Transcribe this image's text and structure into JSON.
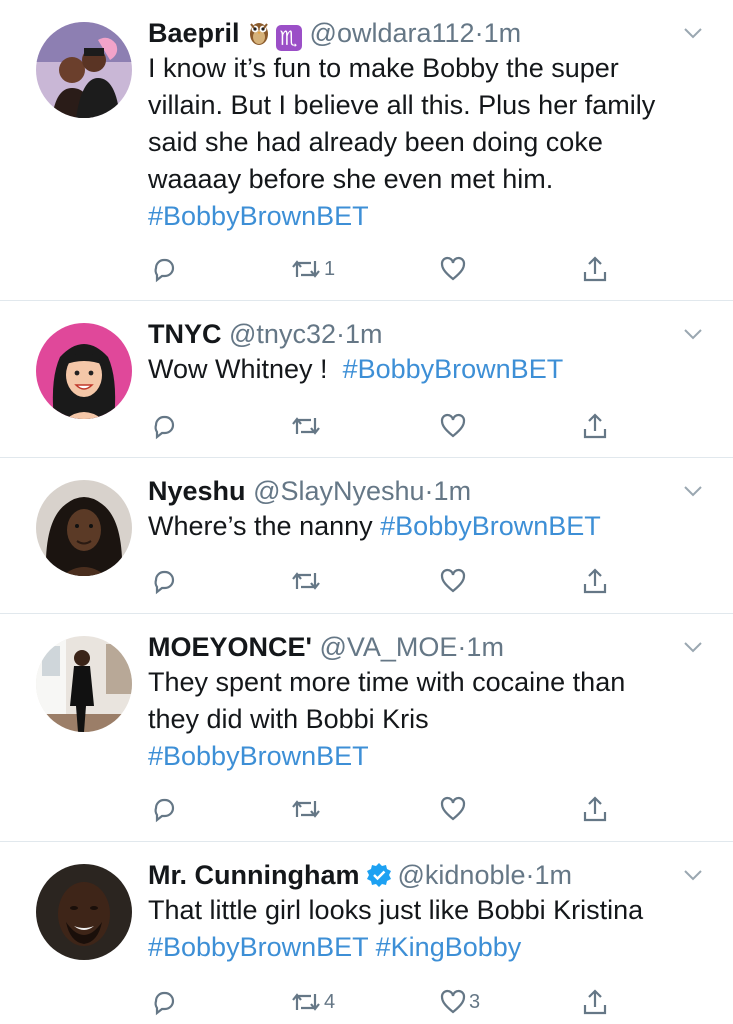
{
  "tweets": [
    {
      "name": "Baepril",
      "emoji_owl": "owl-emoji",
      "zodiac": "♏",
      "handle": "@owldara112",
      "separator": "·",
      "time": "1m",
      "text_lines": [
        "I know it’s fun to make Bobby the super",
        "villain. But I believe all this. Plus her family",
        "said she had already been doing coke",
        "waaaay before she even met him."
      ],
      "hashtags": [
        "#BobbyBrownBET"
      ],
      "retweets": "1",
      "likes": ""
    },
    {
      "name": "TNYC",
      "handle": "@tnyc32",
      "separator": "·",
      "time": "1m",
      "text": "Wow Whitney !",
      "hashtags": [
        "#BobbyBrownBET"
      ],
      "retweets": "",
      "likes": ""
    },
    {
      "name": "Nyeshu",
      "handle": "@SlayNyeshu",
      "separator": "·",
      "time": "1m",
      "text": "Where’s the nanny",
      "hashtags": [
        "#BobbyBrownBET"
      ],
      "retweets": "",
      "likes": ""
    },
    {
      "name": "MOEYONCE'",
      "handle": "@VA_MOE",
      "separator": "·",
      "time": "1m",
      "text_lines": [
        "They spent more time with cocaine than",
        "they did with Bobbi Kris"
      ],
      "hashtags": [
        "#BobbyBrownBET"
      ],
      "retweets": "",
      "likes": ""
    },
    {
      "name": "Mr. Cunningham",
      "verified": true,
      "handle": "@kidnoble",
      "separator": "·",
      "time": "1m",
      "text": "That little girl looks just like Bobbi Kristina",
      "hashtags": [
        "#BobbyBrownBET",
        "#KingBobby"
      ],
      "retweets": "4",
      "likes": "3"
    }
  ],
  "colors": {
    "accent": "#3d8fd6",
    "muted": "#657786",
    "divider": "#e1e8ed",
    "verified": "#1da1f2",
    "zodiac_bg": "#9b4fc7",
    "tnyc_avatar_bg": "#e0489a"
  },
  "icons": [
    "reply-icon",
    "retweet-icon",
    "like-icon",
    "share-icon",
    "chevron-down-icon",
    "verified-badge-icon"
  ]
}
